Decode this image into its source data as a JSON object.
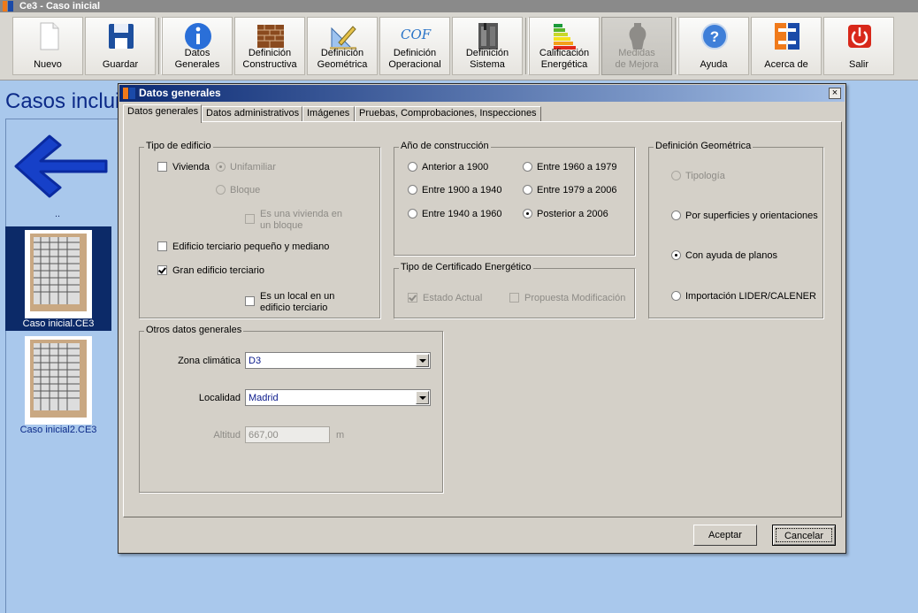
{
  "window": {
    "title": "Ce3 - Caso inicial"
  },
  "toolbar": {
    "nuevo": "Nuevo",
    "guardar": "Guardar",
    "datos_generales": [
      "Datos",
      "Generales"
    ],
    "def_constructiva": [
      "Definición",
      "Constructiva"
    ],
    "def_geometrica": [
      "Definición",
      "Geométrica"
    ],
    "def_operacional": [
      "Definición",
      "Operacional"
    ],
    "def_sistema": [
      "Definición",
      "Sistema"
    ],
    "calificacion": [
      "Calificación",
      "Energética"
    ],
    "medidas": [
      "Medidas",
      "de Mejora"
    ],
    "ayuda": "Ayuda",
    "acerca": "Acerca de",
    "salir": "Salir",
    "cof_icon_text": "COF"
  },
  "main": {
    "heading": "Casos incluidos",
    "parent_dir": "..",
    "files": [
      "Caso inicial.CE3",
      "Caso inicial2.CE3"
    ]
  },
  "dialog": {
    "title": "Datos generales",
    "close": "×",
    "tabs": [
      "Datos generales",
      "Datos administrativos",
      "Imágenes",
      "Pruebas, Comprobaciones, Inspecciones"
    ],
    "tipo_edificio": {
      "title": "Tipo de edificio",
      "vivienda": "Vivienda",
      "unifamiliar": "Unifamiliar",
      "bloque": "Bloque",
      "vivienda_en_bloque": [
        "Es una vivienda en",
        "un bloque"
      ],
      "terciario_pequeno": "Edificio terciario pequeño y mediano",
      "gran_terciario": "Gran edificio terciario",
      "local_en_terciario": [
        "Es un local en un",
        "edificio terciario"
      ]
    },
    "anio_construccion": {
      "title": "Año de construcción",
      "options": [
        "Anterior a 1900",
        "Entre 1960 a 1979",
        "Entre 1900 a 1940",
        "Entre 1979 a 2006",
        "Entre 1940 a 1960",
        "Posterior a 2006"
      ],
      "selected": "Posterior a 2006"
    },
    "tipo_certificado": {
      "title": "Tipo de Certificado Energético",
      "estado_actual": "Estado Actual",
      "propuesta": "Propuesta Modificación"
    },
    "definicion_geometrica": {
      "title": "Definición Geométrica",
      "tipologia": "Tipología",
      "superficies": "Por superficies y orientaciones",
      "planos": "Con ayuda de planos",
      "lider": "Importación LIDER/CALENER",
      "selected": "Con ayuda de planos"
    },
    "otros": {
      "title": "Otros datos generales",
      "zona_label": "Zona climática",
      "zona_value": "D3",
      "localidad_label": "Localidad",
      "localidad_value": "Madrid",
      "altitud_label": "Altitud",
      "altitud_value": "667,00",
      "altitud_unit": "m"
    },
    "buttons": {
      "aceptar": "Aceptar",
      "cancelar": "Cancelar"
    }
  },
  "colors": {
    "accent": "#0c2a88",
    "dialog_bg": "#d4d0c8",
    "desktop": "#a9c8ec"
  }
}
